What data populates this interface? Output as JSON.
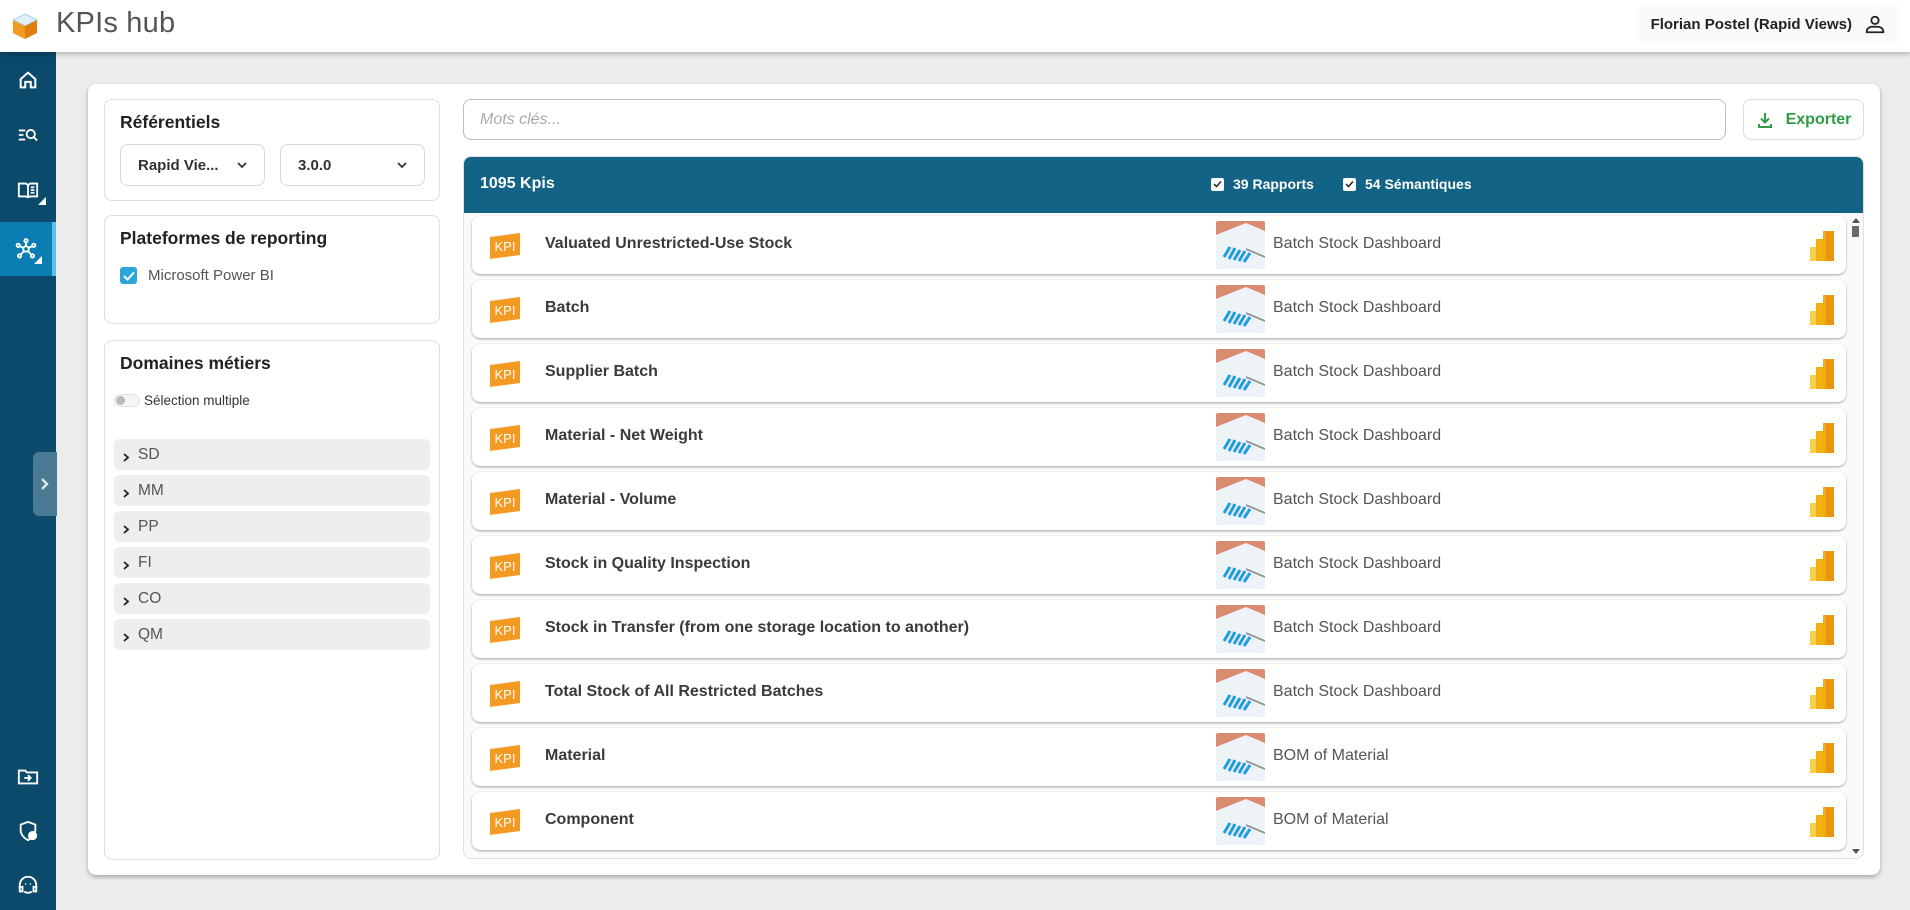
{
  "header": {
    "app_title": "KPIs hub",
    "user_name": "Florian Postel (Rapid Views)"
  },
  "sidebar": {
    "items": [
      {
        "icon": "home-icon"
      },
      {
        "icon": "search-list-icon"
      },
      {
        "icon": "book-icon"
      },
      {
        "icon": "network-icon",
        "active": true
      }
    ],
    "bottom_items": [
      {
        "icon": "folder-import-icon"
      },
      {
        "icon": "shield-user-icon"
      },
      {
        "icon": "support-icon"
      }
    ]
  },
  "filters": {
    "referentiels": {
      "title": "Référentiels",
      "source_value": "Rapid Vie...",
      "version_value": "3.0.0"
    },
    "platforms": {
      "title": "Plateformes de reporting",
      "items": [
        {
          "label": "Microsoft Power BI",
          "checked": true
        }
      ]
    },
    "domains": {
      "title": "Domaines métiers",
      "multi_select_label": "Sélection multiple",
      "multi_select_on": false,
      "items": [
        "SD",
        "MM",
        "PP",
        "FI",
        "CO",
        "QM"
      ]
    }
  },
  "search": {
    "placeholder": "Mots clés...",
    "value": ""
  },
  "export_label": "Exporter",
  "list": {
    "kpi_count": "1095 Kpis",
    "reports_filter": {
      "label": "39 Rapports",
      "checked": true
    },
    "semantics_filter": {
      "label": "54 Sémantiques",
      "checked": true
    },
    "kpi_badge_text": "KPI",
    "rows": [
      {
        "name": "Valuated Unrestricted-Use Stock",
        "report": "Batch Stock Dashboard",
        "platform": "power-bi"
      },
      {
        "name": "Batch",
        "report": "Batch Stock Dashboard",
        "platform": "power-bi"
      },
      {
        "name": "Supplier Batch",
        "report": "Batch Stock Dashboard",
        "platform": "power-bi"
      },
      {
        "name": "Material - Net Weight",
        "report": "Batch Stock Dashboard",
        "platform": "power-bi"
      },
      {
        "name": "Material - Volume",
        "report": "Batch Stock Dashboard",
        "platform": "power-bi"
      },
      {
        "name": "Stock in Quality Inspection",
        "report": "Batch Stock Dashboard",
        "platform": "power-bi"
      },
      {
        "name": "Stock in Transfer (from one storage location to another)",
        "report": "Batch Stock Dashboard",
        "platform": "power-bi"
      },
      {
        "name": "Total Stock of All Restricted Batches",
        "report": "Batch Stock Dashboard",
        "platform": "power-bi"
      },
      {
        "name": "Material",
        "report": "BOM of Material",
        "platform": "power-bi"
      },
      {
        "name": "Component",
        "report": "BOM of Material",
        "platform": "power-bi"
      }
    ]
  },
  "colors": {
    "sidebar": "#0b4a6b",
    "sidebar_active": "#0a7db3",
    "list_header": "#126385",
    "export_green": "#2e9b45",
    "kpi_orange": "#f39a24",
    "checkbox_blue": "#2aa6d8"
  }
}
